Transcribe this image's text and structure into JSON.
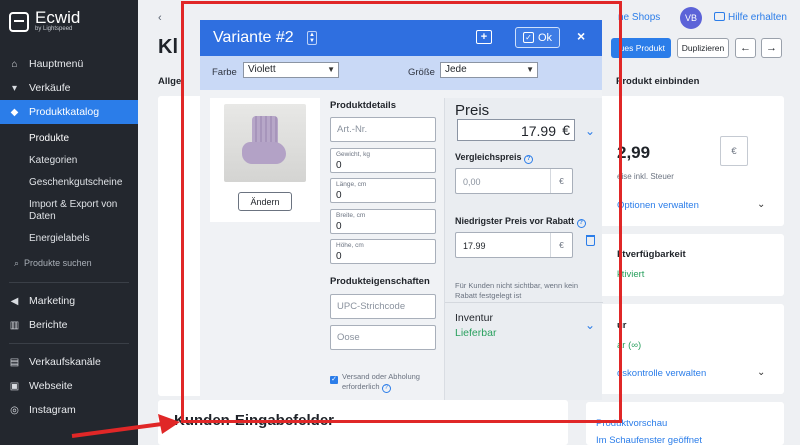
{
  "sidebar": {
    "logo_name": "Ecwid",
    "logo_sub": "by Lightspeed",
    "items": [
      {
        "label": "Hauptmenü",
        "icon": "home-icon"
      },
      {
        "label": "Verkäufe",
        "icon": "cart-icon"
      },
      {
        "label": "Produktkatalog",
        "icon": "tag-icon"
      }
    ],
    "subitems": [
      "Produkte",
      "Kategorien",
      "Geschenkgutscheine",
      "Import & Export von Daten",
      "Energielabels"
    ],
    "search_label": "Produkte suchen",
    "items2": [
      {
        "label": "Marketing",
        "icon": "megaphone-icon"
      },
      {
        "label": "Berichte",
        "icon": "chart-icon"
      }
    ],
    "items3": [
      {
        "label": "Verkaufskanäle",
        "icon": "storefront-icon"
      },
      {
        "label": "Webseite",
        "icon": "website-icon"
      },
      {
        "label": "Instagram",
        "icon": "instagram-icon"
      }
    ]
  },
  "topbar": {
    "shops": "ne Shops",
    "avatar": "VB",
    "help": "Hilfe erhalten"
  },
  "page": {
    "title": "Kl",
    "save_button": "ues Produkt",
    "duplicate_button": "Duplizieren",
    "tab_left": "Allge",
    "tab_right": "Produkt einbinden",
    "section_bottom": "Kunden-Eingabefelder",
    "right_price": "2,99",
    "right_currency": "€",
    "right_tax": "eise inkl. Steuer",
    "right_options_link": "Optionen verwalten",
    "right_availability_title": "ktverfügbarkeit",
    "right_availability_value": "ktiviert",
    "right_stock_title": "ur",
    "right_stock_value": "ar (∞)",
    "right_stock_link": "dskontrolle verwalten",
    "right_preview_link": "Produktvorschau",
    "right_storefront_link": "Im Schaufenster geöffnet"
  },
  "modal": {
    "title": "Variante #2",
    "ok_label": "Ok",
    "close_label": "×",
    "filter": {
      "color_label": "Farbe",
      "color_value": "Violett",
      "size_label": "Größe",
      "size_value": "Jede"
    },
    "change_button": "Ändern",
    "details_title": "Produktdetails",
    "sku_placeholder": "Art.-Nr.",
    "weight_label": "Gewicht, kg",
    "weight_value": "0",
    "length_label": "Länge, cm",
    "length_value": "0",
    "width_label": "Breite, cm",
    "width_value": "0",
    "height_label": "Höhe, cm",
    "height_value": "0",
    "attributes_title": "Produkteigenschaften",
    "upc_placeholder": "UPC-Strichcode",
    "other_placeholder": "Oose",
    "shipping_label": "Versand oder Abholung erforderlich",
    "price_title": "Preis",
    "price_value": "17.99",
    "currency": "€",
    "compare_label": "Vergleichspreis",
    "compare_value": "0,00",
    "lowest_label": "Niedrigster Preis vor Rabatt",
    "lowest_value": "17.99",
    "note": "Für Kunden nicht sichtbar, wenn kein Rabatt festgelegt ist",
    "inventory_title": "Inventur",
    "inventory_value": "Lieferbar"
  },
  "colors": {
    "accent": "#2b7de9",
    "modal_header": "#2f6fe0",
    "sidebar": "#23272e",
    "highlight": "#e02727",
    "success": "#29a05e"
  }
}
